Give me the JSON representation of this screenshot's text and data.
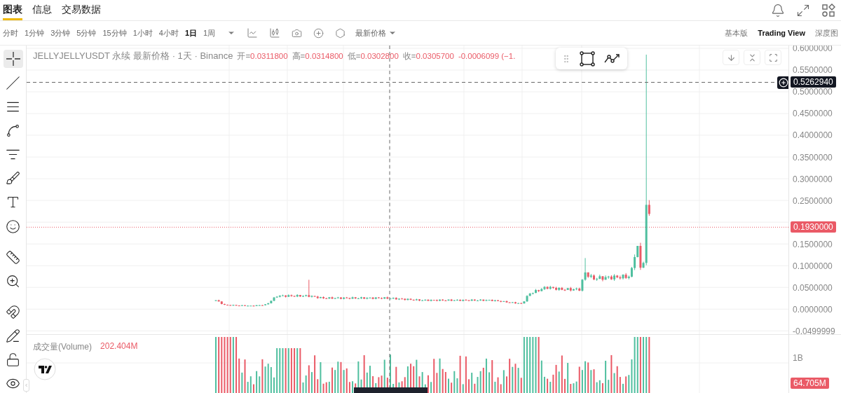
{
  "header_tabs": [
    {
      "label": "图表",
      "selected": true
    },
    {
      "label": "信息",
      "selected": false
    },
    {
      "label": "交易数据",
      "selected": false
    }
  ],
  "intervals": [
    {
      "label": "分时",
      "selected": false
    },
    {
      "label": "1分钟",
      "selected": false
    },
    {
      "label": "3分钟",
      "selected": false
    },
    {
      "label": "5分钟",
      "selected": false
    },
    {
      "label": "15分钟",
      "selected": false
    },
    {
      "label": "1小时",
      "selected": false
    },
    {
      "label": "4小时",
      "selected": false
    },
    {
      "label": "1日",
      "selected": true
    },
    {
      "label": "1周",
      "selected": false
    }
  ],
  "price_source": {
    "label": "最新价格"
  },
  "view_modes": [
    {
      "label": "基本版",
      "selected": false
    },
    {
      "label": "Trading View",
      "selected": true
    },
    {
      "label": "深度图",
      "selected": false
    }
  ],
  "chart": {
    "legend": {
      "title": "JELLYJELLYUSDT 永续 最新价格 · 1天 · Binance",
      "fields": [
        {
          "label": "开=",
          "value": "0.0311800"
        },
        {
          "label": "高=",
          "value": "0.0314800"
        },
        {
          "label": "低=",
          "value": "0.0302800"
        },
        {
          "label": "收=",
          "value": "0.0305700"
        }
      ],
      "change": "-0.0006099 (−1."
    },
    "price_axis_upper": [
      "0.6000000",
      "0.5500000",
      "0.5000000",
      "0.4500000",
      "0.4000000",
      "0.3500000",
      "0.3000000",
      "0.2500000"
    ],
    "price_axis_lower": [
      "0.1500000",
      "0.1000000",
      "0.0500000",
      "0.0000000",
      "-0.0499999"
    ],
    "crosshair_price": "0.5262940",
    "last_price": "0.1930000"
  },
  "volume": {
    "label": "成交量(Volume)",
    "value": "202.404M",
    "axis_label": "1B",
    "last_value": "64.705M"
  }
}
